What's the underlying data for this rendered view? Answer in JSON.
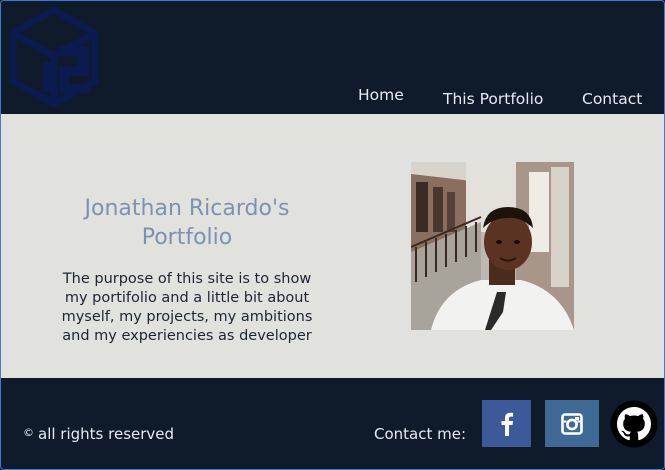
{
  "nav": {
    "home": "Home",
    "portfolio": "This Portfolio",
    "contact": "Contact"
  },
  "hero": {
    "title": "Jonathan Ricardo's Portfolio",
    "description": "The purpose of this site is to show my portifolio and a little bit about myself, my projects, my ambitions and my experiencies as developer"
  },
  "footer": {
    "copyright_symbol": "©",
    "rights": "all rights reserved",
    "contact_label": "Contact me:",
    "social": [
      {
        "icon": "facebook-icon",
        "color": "#3c5a99"
      },
      {
        "icon": "instagram-icon",
        "color": "#3f6a96"
      },
      {
        "icon": "github-icon",
        "color": "#000000"
      }
    ]
  },
  "colors": {
    "header_bg": "#0f1a2a",
    "main_bg": "#e1e1de",
    "title": "#7b93b3",
    "text": "#1d2535",
    "logo": "#0a1a4a"
  }
}
